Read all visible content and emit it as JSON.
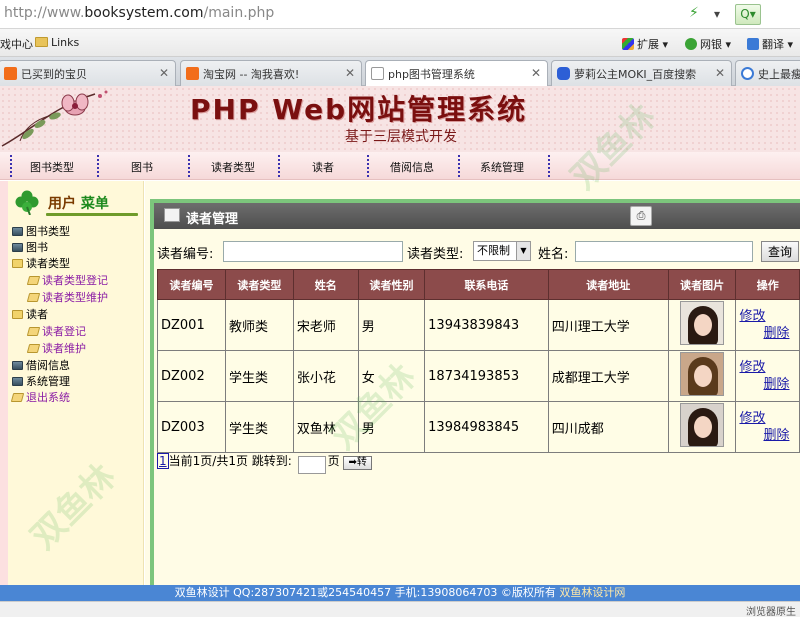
{
  "browser": {
    "url_prefix": "http://www.",
    "url_domain": "booksystem.com",
    "url_path": "/main.php",
    "favorites": [
      {
        "label": "戏中心"
      },
      {
        "label": "Links"
      },
      {
        "label": "扩展"
      },
      {
        "label": "网银"
      },
      {
        "label": "翻译"
      }
    ],
    "tabs": [
      {
        "label": "已买到的宝贝",
        "active": false
      },
      {
        "label": "淘宝网 -- 淘我喜欢!",
        "active": false
      },
      {
        "label": "php图书管理系统",
        "active": true
      },
      {
        "label": "萝莉公主MOKI_百度搜索",
        "active": false
      },
      {
        "label": "史上最瘦",
        "active": false
      }
    ]
  },
  "header": {
    "title": "PHP Web网站管理系统",
    "subtitle": "基于三层模式开发"
  },
  "nav": {
    "items": [
      "图书类型",
      "图书",
      "读者类型",
      "读者",
      "借阅信息",
      "系统管理"
    ]
  },
  "sidebar": {
    "menu_title_a": "用户",
    "menu_title_b": "菜单",
    "items": [
      {
        "label": "图书类型"
      },
      {
        "label": "图书"
      },
      {
        "label": "读者类型"
      },
      {
        "label": "读者类型登记"
      },
      {
        "label": "读者类型维护"
      },
      {
        "label": "读者"
      },
      {
        "label": "读者登记"
      },
      {
        "label": "读者维护"
      },
      {
        "label": "借阅信息"
      },
      {
        "label": "系统管理"
      },
      {
        "label": "退出系统"
      }
    ]
  },
  "panel": {
    "title": "读者管理"
  },
  "search": {
    "reader_id_label": "读者编号:",
    "reader_id_value": "",
    "reader_type_label": "读者类型:",
    "reader_type_selected": "不限制",
    "name_label": "姓名:",
    "name_value": "",
    "query_button": "查询"
  },
  "table": {
    "headers": [
      "读者编号",
      "读者类型",
      "姓名",
      "读者性别",
      "联系电话",
      "读者地址",
      "读者图片",
      "操作"
    ],
    "rows": [
      {
        "id": "DZ001",
        "type": "教师类",
        "name": "宋老师",
        "gender": "男",
        "phone": "13943839843",
        "address": "四川理工大学",
        "edit": "修改",
        "delete": "删除"
      },
      {
        "id": "DZ002",
        "type": "学生类",
        "name": "张小花",
        "gender": "女",
        "phone": "18734193853",
        "address": "成都理工大学",
        "edit": "修改",
        "delete": "删除"
      },
      {
        "id": "DZ003",
        "type": "学生类",
        "name": "双鱼林",
        "gender": "男",
        "phone": "13984983845",
        "address": "四川成都",
        "edit": "修改",
        "delete": "删除"
      }
    ]
  },
  "pager": {
    "page_link": "1",
    "info": "当前1页/共1页 跳转到:",
    "page_suffix": "页",
    "go_button": "➡转"
  },
  "footer": {
    "text": "双鱼林设计 QQ:287307421或254540457 手机:13908064703 ©版权所有",
    "designer": "双鱼林设计网"
  },
  "status_bar": {
    "text": "浏览器原生"
  }
}
